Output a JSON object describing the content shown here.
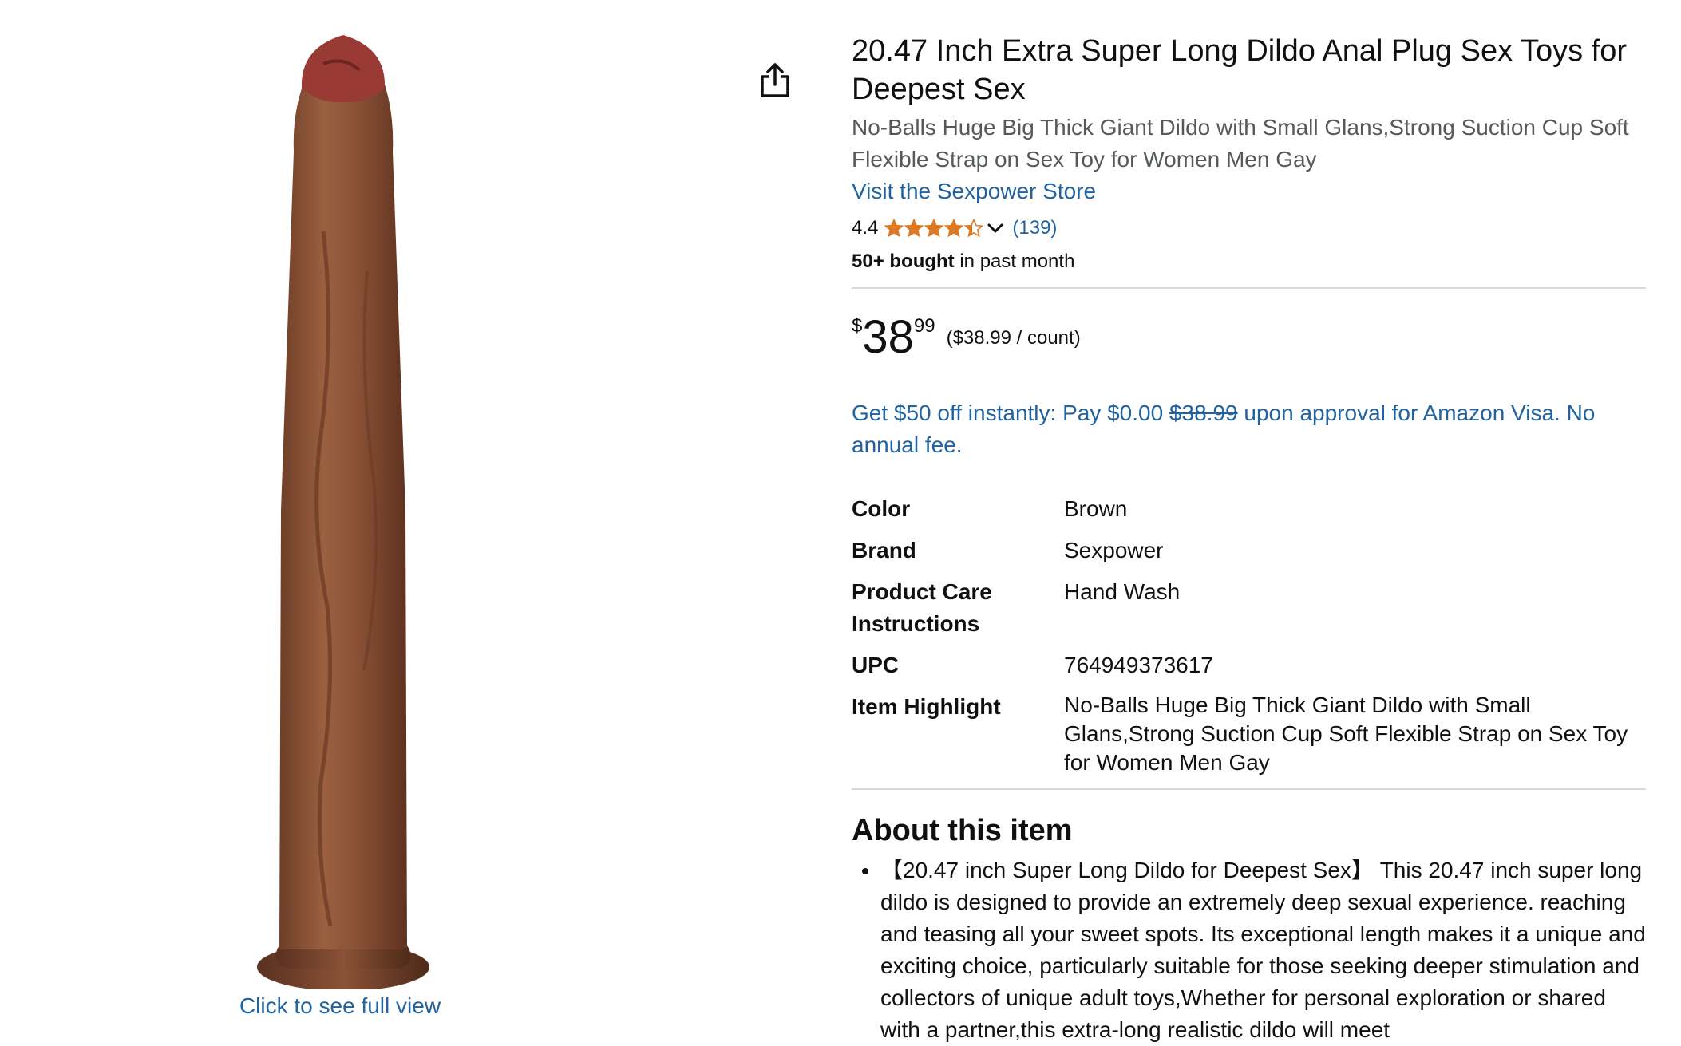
{
  "image": {
    "caption": "Click to see full view"
  },
  "share": {
    "icon": "share-icon"
  },
  "product": {
    "title": "20.47 Inch Extra Super Long Dildo Anal Plug Sex Toys for Deepest Sex",
    "subtitle": "No-Balls Huge Big Thick Giant Dildo with Small Glans,Strong Suction Cup Soft Flexible Strap on Sex Toy for Women Men Gay",
    "store_link": "Visit the Sexpower Store",
    "rating": "4.4",
    "rating_stars": 4.4,
    "rating_count": "(139)",
    "bought_bold": "50+ bought",
    "bought_rest": " in past month"
  },
  "price": {
    "symbol": "$",
    "whole": "38",
    "fraction": "99",
    "unit": "($38.99 / count)"
  },
  "promo": {
    "text_before": "Get $50 off instantly: Pay $0.00 ",
    "strike": "$38.99",
    "text_after": " upon approval for Amazon Visa. No annual fee."
  },
  "specs": [
    {
      "key": "Color",
      "value": "Brown"
    },
    {
      "key": "Brand",
      "value": "Sexpower"
    },
    {
      "key": "Product Care Instructions",
      "value": "Hand Wash"
    },
    {
      "key": "UPC",
      "value": "764949373617"
    },
    {
      "key": "Item Highlight",
      "value": "No-Balls Huge Big Thick Giant Dildo with Small Glans,Strong Suction Cup Soft Flexible Strap on Sex Toy for Women Men Gay"
    }
  ],
  "about": {
    "title": "About this item",
    "bullets": [
      "【20.47 inch Super Long Dildo for Deepest Sex】 This 20.47 inch super long dildo is designed to provide an extremely deep sexual experience. reaching and teasing all your sweet spots. Its exceptional length makes it a unique and exciting choice, particularly suitable for those seeking deeper stimulation and collectors of unique adult toys,Whether for personal exploration or shared with a partner,this extra-long realistic dildo will meet"
    ]
  },
  "colors": {
    "link": "#2162a1",
    "star": "#de7921",
    "product_body": "#8a5236",
    "product_tip": "#9a3a35",
    "product_base": "#7a4628"
  }
}
